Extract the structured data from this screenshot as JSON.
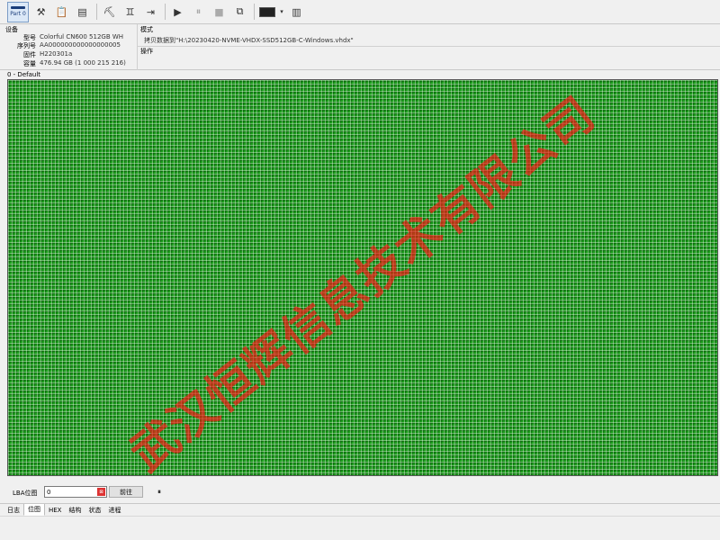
{
  "toolbar": {
    "part_label": "Part 0",
    "tools": [
      "tools-icon",
      "clipboard-icon",
      "report-icon",
      "scanner-icon",
      "binoculars-icon",
      "export-icon",
      "play-icon",
      "pause-icon",
      "stop-icon",
      "copy-icon",
      "monitor-icon",
      "dropdown-icon",
      "stats-icon"
    ]
  },
  "device": {
    "section": "设备",
    "model_key": "型号",
    "model_val": "Colorful CN600 512GB WH",
    "serial_key": "序列号",
    "serial_val": "AA000000000000000005",
    "firmware_key": "固件",
    "firmware_val": "H220301a",
    "capacity_key": "容量",
    "capacity_val": "476.94 GB (1 000 215 216)"
  },
  "mode": {
    "section": "模式",
    "value": "拷贝数据到\"H:\\20230420-NVME-VHDX-SSD512GB-C-Windows.vhdx\"",
    "ops_section": "操作"
  },
  "partition_label": "0 - Default",
  "watermark": "武汉恒辉信息技术有限公司",
  "lba": {
    "label": "LBA位图",
    "value": "0",
    "go_label": "前往",
    "pause_label": "⏸"
  },
  "tabs": [
    "日志",
    "位图",
    "HEX",
    "结构",
    "状态",
    "进程"
  ],
  "active_tab": 1
}
